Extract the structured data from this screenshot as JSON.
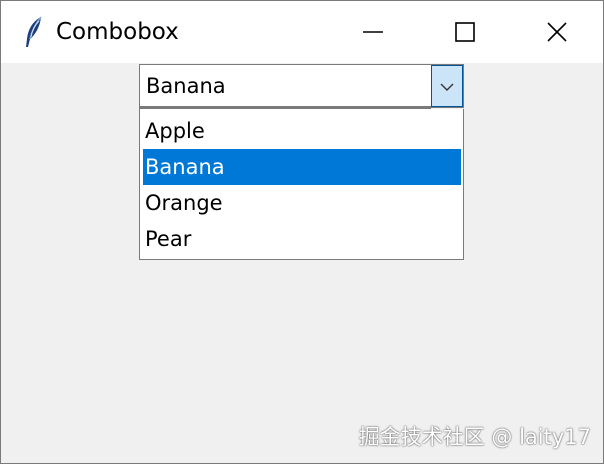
{
  "window": {
    "title": "Combobox",
    "icon": "feather-icon"
  },
  "titlebar_buttons": {
    "minimize_icon": "minimize-icon",
    "maximize_icon": "maximize-icon",
    "close_icon": "close-icon"
  },
  "combobox": {
    "value": "Banana",
    "arrow_icon": "chevron-down-icon",
    "options": [
      "Apple",
      "Banana",
      "Orange",
      "Pear"
    ],
    "selected_index": 1
  },
  "colors": {
    "selection": "#0078d7",
    "arrow_bg": "#cce4f7",
    "window_bg": "#f0f0f0"
  },
  "watermark": "掘金技术社区 @ laity17"
}
